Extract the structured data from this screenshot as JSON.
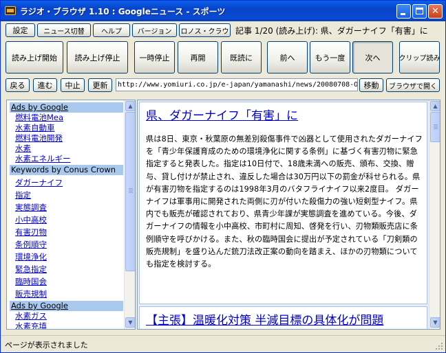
{
  "window": {
    "title": "ラジオ・ブラウザ 1.10 : Googleニュース - スポーツ"
  },
  "toolbar_row1": {
    "settings": "設定",
    "news_switch": "ニュース切替",
    "help": "ヘルプ",
    "version": "バージョン",
    "chronos_crown": "クロノス・クラウン",
    "article_status": "記事 1/20 (読み上げ): 県、ダガーナイフ「有害」に"
  },
  "toolbar_row2": {
    "start_reading": "読み上げ開始",
    "stop_reading": "読み上げ停止",
    "pause": "一時停止",
    "resume": "再開",
    "mark_read": "既読に",
    "prev": "前へ",
    "again": "もう一度",
    "next": "次へ",
    "clip_read": "クリップ読み"
  },
  "toolbar_row3": {
    "back": "戻る",
    "forward": "進む",
    "stop": "中止",
    "refresh": "更新",
    "url": "http://www.yomiuri.co.jp/e-japan/yamanashi/news/20080708-OYT8",
    "move": "移動",
    "open_browser": "ブラウザで開く"
  },
  "sidebar": {
    "ads1_head": "Ads by Google",
    "ads1": [
      "燃料電池Mea",
      "水素自動車",
      "燃料電池開発",
      "水素",
      "水素エネルギー"
    ],
    "keywords_head": "Keywords by Conus Crown",
    "keywords": [
      "ダガーナイフ",
      "指定",
      "実態調査",
      "小中高校",
      "有害刃物",
      "条例順守",
      "環境浄化",
      "緊急指定",
      "臨時国会",
      "販売規制"
    ],
    "ads2_head": "Ads by Google",
    "ads2": [
      "水素ガス",
      "水素充填"
    ]
  },
  "article": {
    "title": "県、ダガーナイフ「有害」に",
    "body": "県は8日、東京・秋葉原の無差別殺傷事件で凶器として使用されたダガーナイフを「青少年保護育成のための環境浄化に関する条例」に基づく有害刃物に緊急指定すると発表した。指定は10日付で、18歳未満への販売、頒布、交換、贈与、貸し付けが禁止され、違反した場合は30万円以下の罰金が科せられる。県が有害刃物を指定するのは1998年3月のバタフライナイフ以来2度目。 ダガーナイフは軍事用に開発された両側に刃が付いた殺傷力の強い短剣型ナイフ。県内でも販売が確認されており、県青少年課が実態調査を進めている。今後、ダガーナイフの情報を小中高校、市町村に周知、啓発を行い、刃物類販売店に条例順守を呼びかける。また、秋の臨時国会に提出が予定されている「刀剣類の販売規制」を盛り込んだ銃刀法改正案の動向を踏まえ、ほかの刃物類についても指定を検討する。"
  },
  "article2": {
    "title": "【主張】温暖化対策 半減目標の具体化が問題"
  },
  "status": {
    "text": "ページが表示されました"
  },
  "colors": {
    "titlebar": "#0a4bd4",
    "link": "#0000cc",
    "ad_header": "#a9c8ee",
    "close_button": "#c8401c"
  }
}
